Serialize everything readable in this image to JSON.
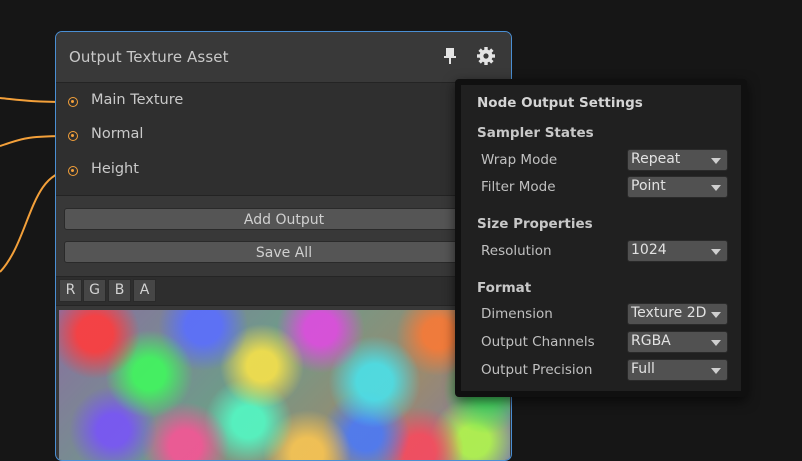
{
  "node": {
    "title": "Output Texture Asset",
    "ports": [
      "Main Texture",
      "Normal",
      "Height"
    ],
    "add_output_label": "Add Output",
    "save_all_label": "Save All",
    "channels": [
      "R",
      "G",
      "B",
      "A"
    ]
  },
  "icons": {
    "pin": "pin-icon",
    "gear": "gear-icon"
  },
  "colors": {
    "wire": "#f3a03a",
    "node_border": "#4a8fd4",
    "background": "#161616"
  },
  "settings_popup": {
    "title": "Node Output Settings",
    "sampler_states": {
      "heading": "Sampler States",
      "wrap_mode": {
        "label": "Wrap Mode",
        "value": "Repeat"
      },
      "filter_mode": {
        "label": "Filter Mode",
        "value": "Point"
      }
    },
    "size_properties": {
      "heading": "Size Properties",
      "resolution": {
        "label": "Resolution",
        "value": "1024"
      }
    },
    "format": {
      "heading": "Format",
      "dimension": {
        "label": "Dimension",
        "value": "Texture 2D"
      },
      "output_channels": {
        "label": "Output Channels",
        "value": "RGBA"
      },
      "output_precision": {
        "label": "Output Precision",
        "value": "Full"
      }
    }
  }
}
